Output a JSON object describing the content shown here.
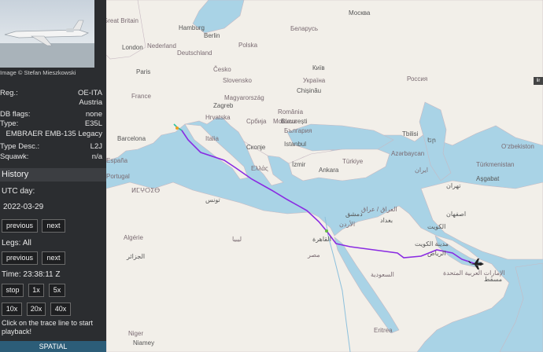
{
  "aircraft": {
    "image_credit": "Image © Stefan Mieszkowski",
    "fields": [
      {
        "key": "Reg.:",
        "value": "OE-ITA"
      },
      {
        "key": "",
        "value": "Austria"
      },
      {
        "key": "DB flags:",
        "value": "none"
      },
      {
        "key": "Type:",
        "value": "E35L"
      },
      {
        "key": "",
        "value": "EMBRAER EMB-135 Legacy"
      },
      {
        "key": "Type Desc.:",
        "value": "L2J"
      },
      {
        "key": "Squawk:",
        "value": "n/a"
      }
    ]
  },
  "history": {
    "title": "History",
    "utc_day_label": "UTC day:",
    "utc_day": "2022-03-29",
    "previous_label": "previous",
    "next_label": "next",
    "legs_label": "Legs: All",
    "time_label": "Time: 23:38:11 Z",
    "speed_buttons": [
      "stop",
      "1x",
      "5x",
      "10x",
      "20x",
      "40x"
    ],
    "hint": "Click on the trace line to start playback!"
  },
  "spatial_label": "SPATIAL",
  "colors": {
    "sidebar_bg": "#2b2d30",
    "sea": "#a9d3e6",
    "land": "#f2efe9",
    "track": "#8a2be2",
    "spatial_bg": "#2c5d78"
  },
  "map": {
    "places": [
      "Great Britain",
      "London",
      "Nederland",
      "Hamburg",
      "Berlin",
      "Polska",
      "Deutschland",
      "Paris",
      "Česko",
      "Slovensko",
      "Magyarország",
      "France",
      "Zagreb",
      "Hrvatska",
      "Србија",
      "Italia",
      "Barcelona",
      "България",
      "București",
      "România",
      "Istanbul",
      "Скопје",
      "Ελλάς",
      "İzmir",
      "Türkiye",
      "Москва",
      "Беларусь",
      "Київ",
      "Україна",
      "Chișinău",
      "Россия",
      "Azərbaycan",
      "ایران",
      "Oʻzbekiston",
      "Türkmenistan",
      "Aşgabat",
      "تهران",
      "اصفهان",
      "العراق / عراق",
      "دمشق",
      "الأردن",
      "القاهرة",
      "مصر",
      "السعودية",
      "الرياض",
      "الكويت",
      "مدينة الكويت",
      "الإمارات العربية المتحدة",
      "مسقط",
      "Algérie",
      "الجزائر",
      "Niger",
      "Niamey",
      "Eritrea",
      "ليبيا",
      "ⵍⵎⵖⵔⵉⴱ",
      "تونس",
      "بغداد",
      "Ankara",
      "Tbilisi",
      "Եր",
      "Moldova",
      "España",
      "Portugal"
    ],
    "scale_badge": "lir"
  }
}
